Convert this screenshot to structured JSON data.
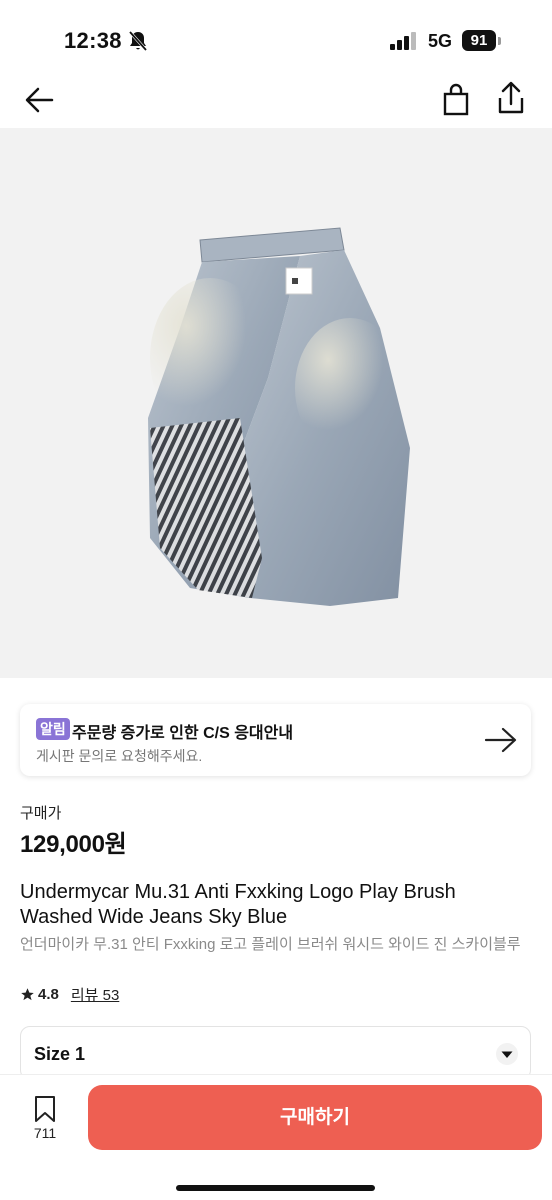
{
  "status_bar": {
    "time": "12:38",
    "network": "5G",
    "battery": "91"
  },
  "icons": {
    "back": "arrow-left-icon",
    "bag": "shopping-bag-icon",
    "share": "share-icon",
    "notice_arrow": "arrow-right-icon",
    "star": "star-icon",
    "chevron": "chevron-down-icon",
    "bookmark": "bookmark-icon"
  },
  "notice": {
    "badge": "알림",
    "title": "주문량 증가로 인한 C/S 응대안내",
    "subtitle": "게시판 문의로 요청해주세요."
  },
  "price": {
    "label": "구매가",
    "value": "129,000원"
  },
  "product": {
    "title_en": "Undermycar Mu.31 Anti Fxxking Logo Play Brush Washed Wide Jeans Sky Blue",
    "title_ko": "언더마이카 무.31 안티 Fxxking 로고 플레이 브러쉬 워시드 와이드 진 스카이블루",
    "rating": "4.8",
    "reviews": "리뷰 53"
  },
  "size_select": {
    "value": "Size 1"
  },
  "bottom_bar": {
    "bookmark_count": "711",
    "buy_label": "구매하기"
  },
  "colors": {
    "accent": "#ee5f52",
    "badge": "#8a74d6"
  }
}
